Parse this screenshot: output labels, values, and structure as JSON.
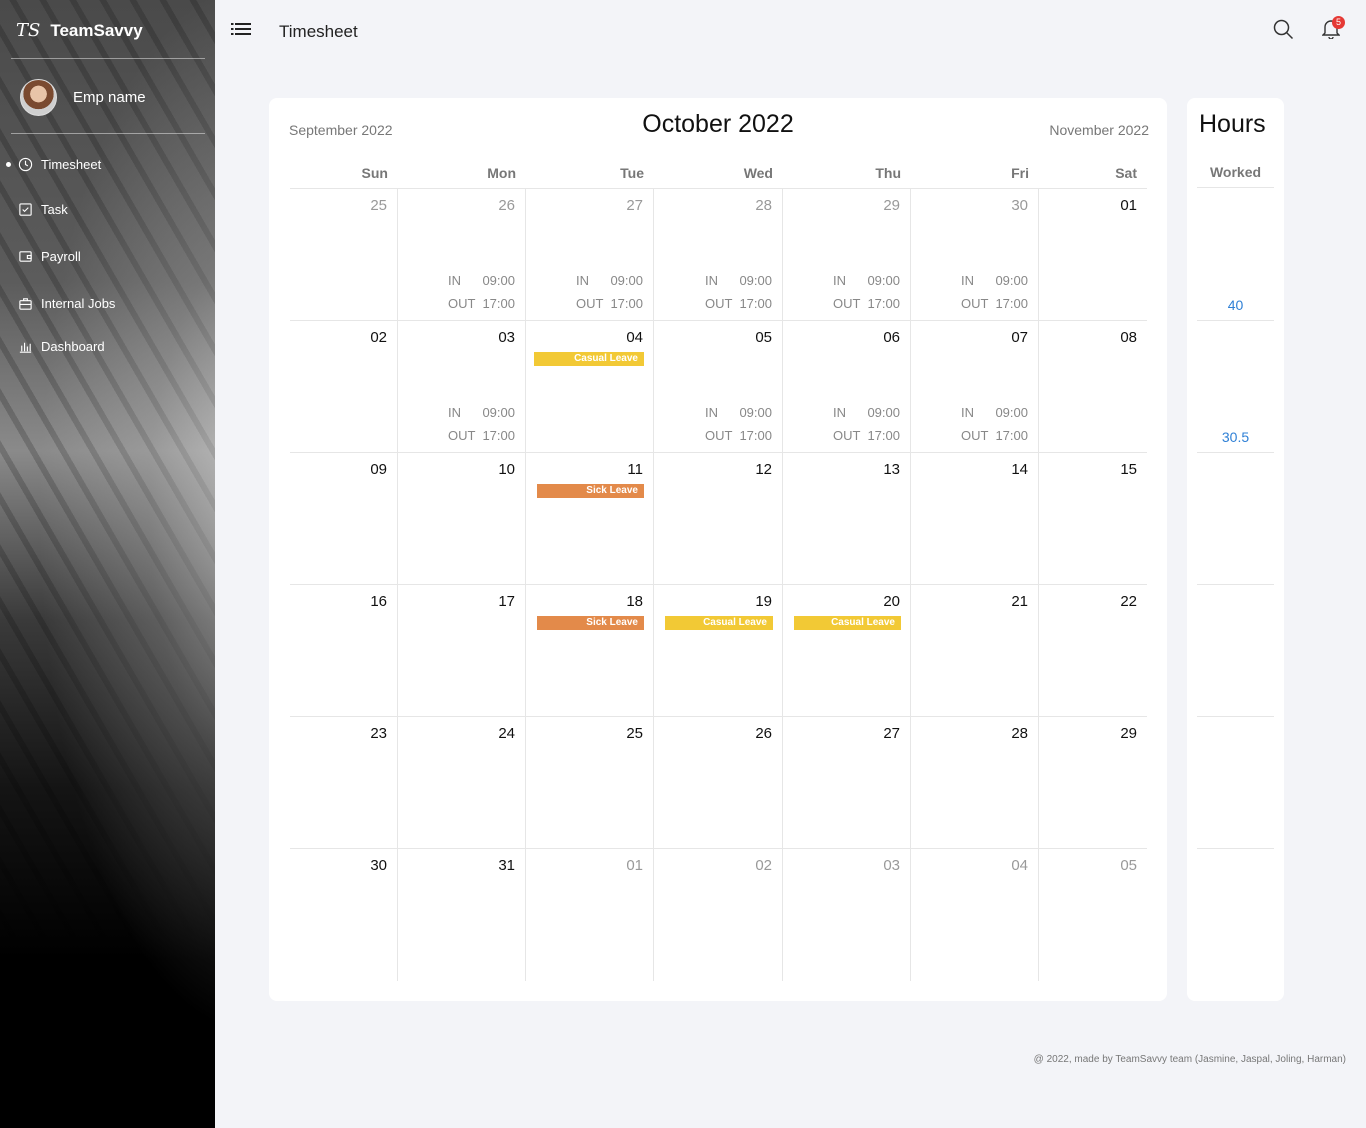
{
  "app": {
    "logo": "TS",
    "name": "TeamSavvy"
  },
  "user": {
    "name": "Emp name"
  },
  "nav": [
    {
      "label": "Timesheet",
      "icon": "clock-icon",
      "active": true
    },
    {
      "label": "Task",
      "icon": "task-icon",
      "active": false
    },
    {
      "label": "Payroll",
      "icon": "wallet-icon",
      "active": false
    },
    {
      "label": "Internal Jobs",
      "icon": "briefcase-icon",
      "active": false
    },
    {
      "label": "Dashboard",
      "icon": "chart-icon",
      "active": false
    }
  ],
  "header": {
    "title": "Timesheet",
    "notifications": "5"
  },
  "calendar": {
    "prev_month": "September 2022",
    "current_month": "October 2022",
    "next_month": "November 2022",
    "weekdays": [
      "Sun",
      "Mon",
      "Tue",
      "Wed",
      "Thu",
      "Fri",
      "Sat"
    ],
    "in_label": "IN",
    "out_label": "OUT",
    "weeks": [
      [
        {
          "day": "25",
          "muted": true
        },
        {
          "day": "26",
          "muted": true,
          "in": "09:00",
          "out": "17:00"
        },
        {
          "day": "27",
          "muted": true,
          "in": "09:00",
          "out": "17:00"
        },
        {
          "day": "28",
          "muted": true,
          "in": "09:00",
          "out": "17:00"
        },
        {
          "day": "29",
          "muted": true,
          "in": "09:00",
          "out": "17:00"
        },
        {
          "day": "30",
          "muted": true,
          "in": "09:00",
          "out": "17:00"
        },
        {
          "day": "01"
        }
      ],
      [
        {
          "day": "02"
        },
        {
          "day": "03",
          "in": "09:00",
          "out": "17:00"
        },
        {
          "day": "04",
          "leave": "Casual Leave",
          "leave_type": "casual"
        },
        {
          "day": "05",
          "in": "09:00",
          "out": "17:00"
        },
        {
          "day": "06",
          "in": "09:00",
          "out": "17:00"
        },
        {
          "day": "07",
          "in": "09:00",
          "out": "17:00"
        },
        {
          "day": "08"
        }
      ],
      [
        {
          "day": "09"
        },
        {
          "day": "10"
        },
        {
          "day": "11",
          "leave": "Sick Leave",
          "leave_type": "sick"
        },
        {
          "day": "12"
        },
        {
          "day": "13"
        },
        {
          "day": "14"
        },
        {
          "day": "15"
        }
      ],
      [
        {
          "day": "16"
        },
        {
          "day": "17"
        },
        {
          "day": "18",
          "leave": "Sick Leave",
          "leave_type": "sick"
        },
        {
          "day": "19",
          "leave": "Casual Leave",
          "leave_type": "casual"
        },
        {
          "day": "20",
          "leave": "Casual Leave",
          "leave_type": "casual"
        },
        {
          "day": "21"
        },
        {
          "day": "22"
        }
      ],
      [
        {
          "day": "23"
        },
        {
          "day": "24"
        },
        {
          "day": "25"
        },
        {
          "day": "26"
        },
        {
          "day": "27"
        },
        {
          "day": "28"
        },
        {
          "day": "29"
        }
      ],
      [
        {
          "day": "30"
        },
        {
          "day": "31"
        },
        {
          "day": "01",
          "muted": true
        },
        {
          "day": "02",
          "muted": true
        },
        {
          "day": "03",
          "muted": true
        },
        {
          "day": "04",
          "muted": true
        },
        {
          "day": "05",
          "muted": true
        }
      ]
    ]
  },
  "hours": {
    "title": "Hours",
    "subtitle": "Worked",
    "weeks": [
      "40",
      "30.5",
      "",
      "",
      "",
      ""
    ]
  },
  "colors": {
    "casual": "#f2c935",
    "sick": "#e38a4a",
    "hours_value": "#2f80d6",
    "badge": "#e53935"
  },
  "footer": "@ 2022, made by TeamSavvy team (Jasmine, Jaspal, Joling, Harman)"
}
